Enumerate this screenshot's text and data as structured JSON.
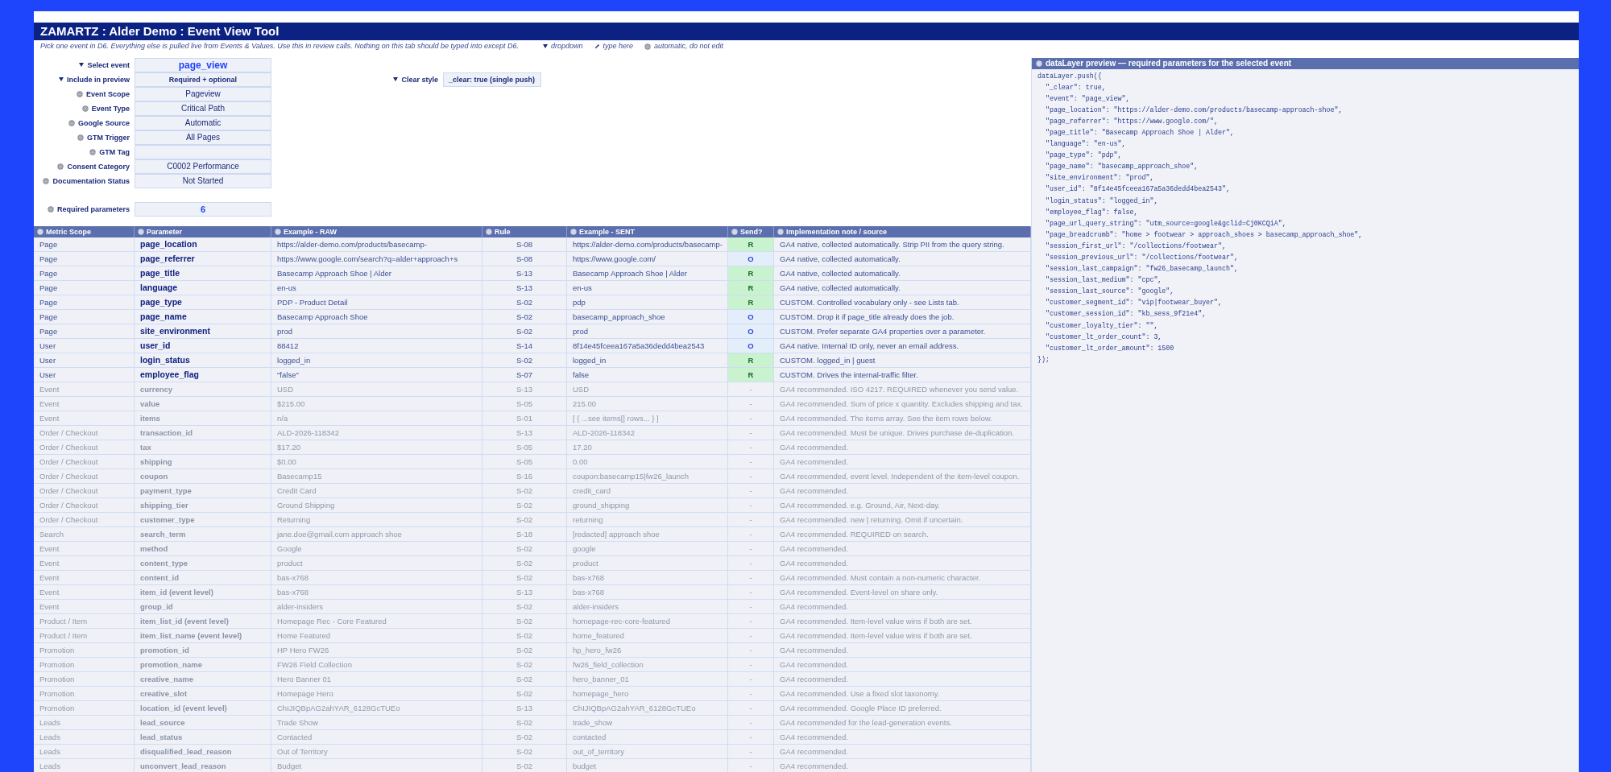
{
  "title": "ZAMARTZ : Alder Demo : Event View Tool",
  "instructions": "Pick one event in D6. Everything else is pulled live from Events & Values. Use this in review calls. Nothing on this tab should be typed into except D6.",
  "legend": [
    {
      "kind": "dropdown",
      "label": "dropdown"
    },
    {
      "kind": "input",
      "label": "type here"
    },
    {
      "kind": "automatic",
      "label": "automatic, do not edit"
    }
  ],
  "fields": [
    {
      "kind": "dropdown",
      "label": "Select event",
      "value": "page_view",
      "highlight": true
    },
    {
      "kind": "dropdown",
      "label": "Include in preview",
      "value": "Required + optional",
      "highlight": false
    },
    {
      "kind": "automatic",
      "label": "Event Scope",
      "value": "Pageview",
      "highlight": false
    },
    {
      "kind": "automatic",
      "label": "Event Type",
      "value": "Critical Path",
      "highlight": false
    },
    {
      "kind": "automatic",
      "label": "Google Source",
      "value": "Automatic",
      "highlight": false
    },
    {
      "kind": "automatic",
      "label": "GTM Trigger",
      "value": "All Pages",
      "highlight": false
    },
    {
      "kind": "automatic",
      "label": "GTM Tag"
    },
    {
      "kind": "automatic",
      "label": "Consent Category",
      "value": "C0002 Performance",
      "highlight": false
    },
    {
      "kind": "automatic",
      "label": "Documentation Status",
      "value": "Not Started",
      "highlight": false
    }
  ],
  "clear_style": {
    "kind": "dropdown",
    "label": "Clear style",
    "value": "_clear: true (single push)"
  },
  "required_parameters": {
    "kind": "automatic",
    "label": "Required parameters",
    "value": "6"
  },
  "table": {
    "columns": [
      "Metric Scope",
      "Parameter",
      "Example - RAW",
      "Rule",
      "Example - SENT",
      "Send?",
      "Implementation note / source"
    ],
    "rows": [
      {
        "kind": "required",
        "scope": "Page",
        "parameter": "page_location",
        "raw": "https://alder-demo.com/products/basecamp-",
        "rule": "S-08",
        "sent": "https://alder-demo.com/products/basecamp-",
        "send": "R",
        "note": "GA4 native, collected automatically. Strip PII from the query string."
      },
      {
        "kind": "optional",
        "scope": "Page",
        "parameter": "page_referrer",
        "raw": "https://www.google.com/search?q=alder+approach+s",
        "rule": "S-08",
        "sent": "https://www.google.com/",
        "send": "O",
        "note": "GA4 native, collected automatically."
      },
      {
        "kind": "required",
        "scope": "Page",
        "parameter": "page_title",
        "raw": "Basecamp Approach Shoe | Alder",
        "rule": "S-13",
        "sent": "Basecamp Approach Shoe | Alder",
        "send": "R",
        "note": "GA4 native, collected automatically."
      },
      {
        "kind": "required",
        "scope": "Page",
        "parameter": "language",
        "raw": "en-us",
        "rule": "S-13",
        "sent": "en-us",
        "send": "R",
        "note": "GA4 native, collected automatically."
      },
      {
        "kind": "required",
        "scope": "Page",
        "parameter": "page_type",
        "raw": "PDP - Product Detail",
        "rule": "S-02",
        "sent": "pdp",
        "send": "R",
        "note": "CUSTOM. Controlled vocabulary only - see Lists tab."
      },
      {
        "kind": "optional",
        "scope": "Page",
        "parameter": "page_name",
        "raw": "Basecamp Approach Shoe",
        "rule": "S-02",
        "sent": "basecamp_approach_shoe",
        "send": "O",
        "note": "CUSTOM. Drop it if page_title already does the job."
      },
      {
        "kind": "optional",
        "scope": "Page",
        "parameter": "site_environment",
        "raw": "prod",
        "rule": "S-02",
        "sent": "prod",
        "send": "O",
        "note": "CUSTOM. Prefer separate GA4 properties over a parameter."
      },
      {
        "kind": "optional",
        "scope": "User",
        "parameter": "user_id",
        "raw": "88412",
        "rule": "S-14",
        "sent": "8f14e45fceea167a5a36dedd4bea2543",
        "send": "O",
        "note": "GA4 native. Internal ID only, never an email address."
      },
      {
        "kind": "required",
        "scope": "User",
        "parameter": "login_status",
        "raw": "logged_in",
        "rule": "S-02",
        "sent": "logged_in",
        "send": "R",
        "note": "CUSTOM. logged_in | guest"
      },
      {
        "kind": "required",
        "scope": "User",
        "parameter": "employee_flag",
        "raw": "\"false\"",
        "rule": "S-07",
        "sent": "false",
        "send": "R",
        "note": "CUSTOM. Drives the internal-traffic filter."
      },
      {
        "kind": "skipped",
        "scope": "Event",
        "parameter": "currency",
        "raw": "USD",
        "rule": "S-13",
        "sent": "USD",
        "send": "-",
        "note": "GA4 recommended. ISO 4217. REQUIRED whenever you send value."
      },
      {
        "kind": "skipped",
        "scope": "Event",
        "parameter": "value",
        "raw": "$215.00",
        "rule": "S-05",
        "sent": "215.00",
        "send": "-",
        "note": "GA4 recommended. Sum of price x quantity. Excludes shipping and tax."
      },
      {
        "kind": "skipped",
        "scope": "Event",
        "parameter": "items",
        "raw": "n/a",
        "rule": "S-01",
        "sent": "[ { ...see items[] rows... } ]",
        "send": "-",
        "note": "GA4 recommended. The items array. See the item rows below."
      },
      {
        "kind": "skipped",
        "scope": "Order / Checkout",
        "parameter": "transaction_id",
        "raw": "ALD-2026-118342",
        "rule": "S-13",
        "sent": "ALD-2026-118342",
        "send": "-",
        "note": "GA4 recommended. Must be unique. Drives purchase de-duplication."
      },
      {
        "kind": "skipped",
        "scope": "Order / Checkout",
        "parameter": "tax",
        "raw": "$17.20",
        "rule": "S-05",
        "sent": "17.20",
        "send": "-",
        "note": "GA4 recommended."
      },
      {
        "kind": "skipped",
        "scope": "Order / Checkout",
        "parameter": "shipping",
        "raw": "$0.00",
        "rule": "S-05",
        "sent": "0.00",
        "send": "-",
        "note": "GA4 recommended."
      },
      {
        "kind": "skipped",
        "scope": "Order / Checkout",
        "parameter": "coupon",
        "raw": "Basecamp15",
        "rule": "S-16",
        "sent": "coupon:basecamp15|fw26_launch",
        "send": "-",
        "note": "GA4 recommended, event level. Independent of the item-level coupon."
      },
      {
        "kind": "skipped",
        "scope": "Order / Checkout",
        "parameter": "payment_type",
        "raw": "Credit Card",
        "rule": "S-02",
        "sent": "credit_card",
        "send": "-",
        "note": "GA4 recommended."
      },
      {
        "kind": "skipped",
        "scope": "Order / Checkout",
        "parameter": "shipping_tier",
        "raw": "Ground Shipping",
        "rule": "S-02",
        "sent": "ground_shipping",
        "send": "-",
        "note": "GA4 recommended. e.g. Ground, Air, Next-day."
      },
      {
        "kind": "skipped",
        "scope": "Order / Checkout",
        "parameter": "customer_type",
        "raw": "Returning",
        "rule": "S-02",
        "sent": "returning",
        "send": "-",
        "note": "GA4 recommended. new | returning. Omit if uncertain."
      },
      {
        "kind": "skipped",
        "scope": "Search",
        "parameter": "search_term",
        "raw": "jane.doe@gmail.com approach shoe",
        "rule": "S-18",
        "sent": "[redacted] approach shoe",
        "send": "-",
        "note": "GA4 recommended. REQUIRED on search."
      },
      {
        "kind": "skipped",
        "scope": "Event",
        "parameter": "method",
        "raw": "Google",
        "rule": "S-02",
        "sent": "google",
        "send": "-",
        "note": "GA4 recommended."
      },
      {
        "kind": "skipped",
        "scope": "Event",
        "parameter": "content_type",
        "raw": "product",
        "rule": "S-02",
        "sent": "product",
        "send": "-",
        "note": "GA4 recommended."
      },
      {
        "kind": "skipped",
        "scope": "Event",
        "parameter": "content_id",
        "raw": "bas-x768",
        "rule": "S-02",
        "sent": "bas-x768",
        "send": "-",
        "note": "GA4 recommended. Must contain a non-numeric character."
      },
      {
        "kind": "skipped",
        "scope": "Event",
        "parameter": "item_id (event level)",
        "raw": "bas-x768",
        "rule": "S-13",
        "sent": "bas-x768",
        "send": "-",
        "note": "GA4 recommended. Event-level on share only."
      },
      {
        "kind": "skipped",
        "scope": "Event",
        "parameter": "group_id",
        "raw": "alder-insiders",
        "rule": "S-02",
        "sent": "alder-insiders",
        "send": "-",
        "note": "GA4 recommended."
      },
      {
        "kind": "skipped",
        "scope": "Product / Item",
        "parameter": "item_list_id (event level)",
        "raw": "Homepage Rec - Core Featured",
        "rule": "S-02",
        "sent": "homepage-rec-core-featured",
        "send": "-",
        "note": "GA4 recommended. Item-level value wins if both are set."
      },
      {
        "kind": "skipped",
        "scope": "Product / Item",
        "parameter": "item_list_name (event level)",
        "raw": "Home Featured",
        "rule": "S-02",
        "sent": "home_featured",
        "send": "-",
        "note": "GA4 recommended. Item-level value wins if both are set."
      },
      {
        "kind": "skipped",
        "scope": "Promotion",
        "parameter": "promotion_id",
        "raw": "HP Hero FW26",
        "rule": "S-02",
        "sent": "hp_hero_fw26",
        "send": "-",
        "note": "GA4 recommended."
      },
      {
        "kind": "skipped",
        "scope": "Promotion",
        "parameter": "promotion_name",
        "raw": "FW26 Field Collection",
        "rule": "S-02",
        "sent": "fw26_field_collection",
        "send": "-",
        "note": "GA4 recommended."
      },
      {
        "kind": "skipped",
        "scope": "Promotion",
        "parameter": "creative_name",
        "raw": "Hero Banner 01",
        "rule": "S-02",
        "sent": "hero_banner_01",
        "send": "-",
        "note": "GA4 recommended."
      },
      {
        "kind": "skipped",
        "scope": "Promotion",
        "parameter": "creative_slot",
        "raw": "Homepage Hero",
        "rule": "S-02",
        "sent": "homepage_hero",
        "send": "-",
        "note": "GA4 recommended. Use a fixed slot taxonomy."
      },
      {
        "kind": "skipped",
        "scope": "Promotion",
        "parameter": "location_id (event level)",
        "raw": "ChIJIQBpAG2ahYAR_6128GcTUEo",
        "rule": "S-13",
        "sent": "ChIJIQBpAG2ahYAR_6128GcTUEo",
        "send": "-",
        "note": "GA4 recommended. Google Place ID preferred."
      },
      {
        "kind": "skipped",
        "scope": "Leads",
        "parameter": "lead_source",
        "raw": "Trade Show",
        "rule": "S-02",
        "sent": "trade_show",
        "send": "-",
        "note": "GA4 recommended for the lead-generation events."
      },
      {
        "kind": "skipped",
        "scope": "Leads",
        "parameter": "lead_status",
        "raw": "Contacted",
        "rule": "S-02",
        "sent": "contacted",
        "send": "-",
        "note": "GA4 recommended."
      },
      {
        "kind": "skipped",
        "scope": "Leads",
        "parameter": "disqualified_lead_reason",
        "raw": "Out of Territory",
        "rule": "S-02",
        "sent": "out_of_territory",
        "send": "-",
        "note": "GA4 recommended."
      },
      {
        "kind": "skipped",
        "scope": "Leads",
        "parameter": "unconvert_lead_reason",
        "raw": "Budget",
        "rule": "S-02",
        "sent": "budget",
        "send": "-",
        "note": "GA4 recommended."
      }
    ]
  },
  "preview": {
    "title": "dataLayer preview — required parameters for the selected event",
    "lines": [
      "dataLayer.push({",
      "  \"_clear\": true,",
      "  \"event\": \"page_view\",",
      "  \"page_location\": \"https://alder-demo.com/products/basecamp-approach-shoe\",",
      "  \"page_referrer\": \"https://www.google.com/\",",
      "  \"page_title\": \"Basecamp Approach Shoe | Alder\",",
      "  \"language\": \"en-us\",",
      "  \"page_type\": \"pdp\",",
      "  \"page_name\": \"basecamp_approach_shoe\",",
      "  \"site_environment\": \"prod\",",
      "  \"user_id\": \"8f14e45fceea167a5a36dedd4bea2543\",",
      "  \"login_status\": \"logged_in\",",
      "  \"employee_flag\": false,",
      "  \"page_url_query_string\": \"utm_source=google&gclid=Cj0KCQiA\",",
      "  \"page_breadcrumb\": \"home > footwear > approach_shoes > basecamp_approach_shoe\",",
      "  \"session_first_url\": \"/collections/footwear\",",
      "  \"session_previous_url\": \"/collections/footwear\",",
      "  \"session_last_campaign\": \"fw26_basecamp_launch\",",
      "  \"session_last_medium\": \"cpc\",",
      "  \"session_last_source\": \"google\",",
      "  \"customer_segment_id\": \"vip|footwear_buyer\",",
      "  \"customer_session_id\": \"kb_sess_9f21e4\",",
      "  \"customer_loyalty_tier\": \"\",",
      "  \"customer_lt_order_count\": 3,",
      "  \"customer_lt_order_amount\": 1500",
      "});"
    ]
  }
}
